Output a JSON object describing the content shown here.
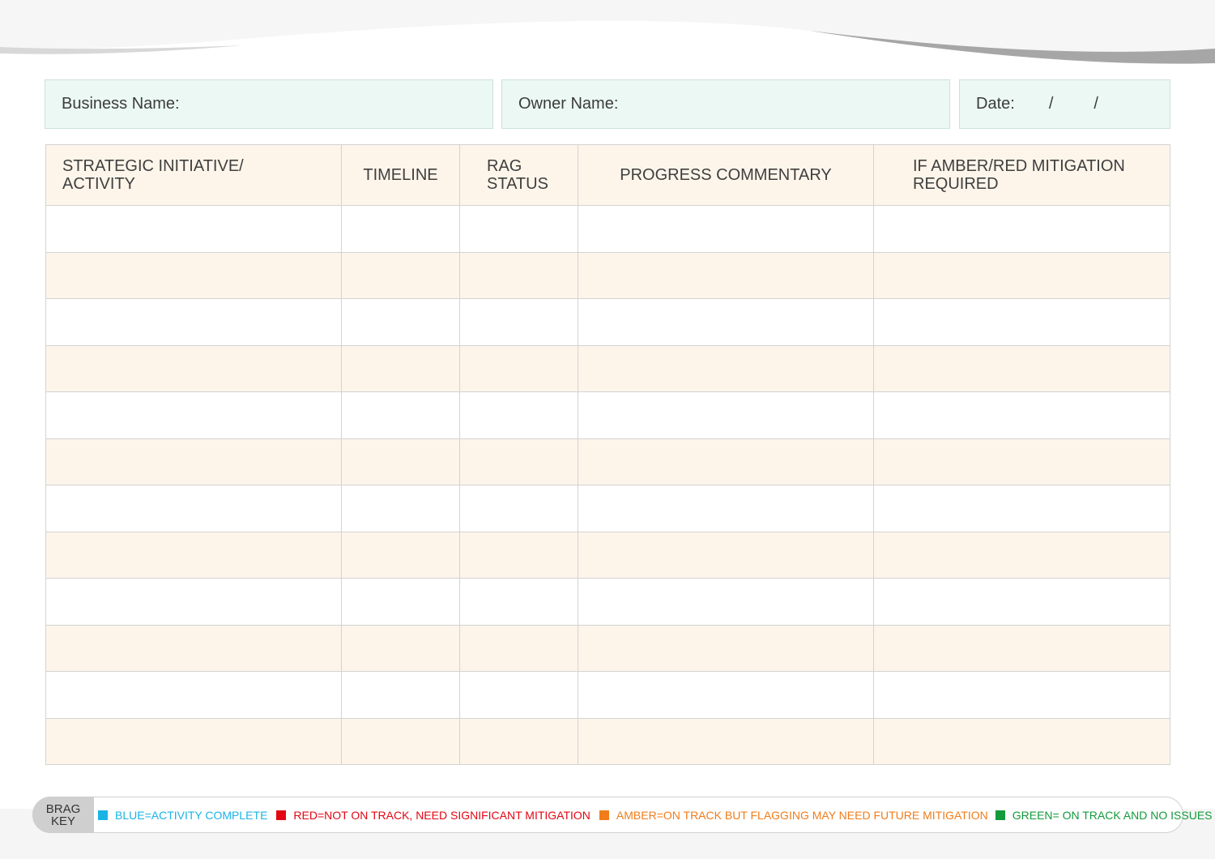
{
  "header_fields": {
    "business_label": "Business Name:",
    "owner_label": "Owner Name:",
    "date_label": "Date:",
    "date_separator": "/"
  },
  "table": {
    "columns": [
      {
        "line1": "STRATEGIC INITIATIVE/",
        "line2": "ACTIVITY"
      },
      {
        "line1": "TIMELINE",
        "line2": ""
      },
      {
        "line1": "RAG",
        "line2": "STATUS"
      },
      {
        "line1": "PROGRESS COMMENTARY",
        "line2": ""
      },
      {
        "line1": "IF AMBER/RED MITIGATION",
        "line2": "REQUIRED"
      }
    ],
    "rows": [
      [
        "",
        "",
        "",
        "",
        ""
      ],
      [
        "",
        "",
        "",
        "",
        ""
      ],
      [
        "",
        "",
        "",
        "",
        ""
      ],
      [
        "",
        "",
        "",
        "",
        ""
      ],
      [
        "",
        "",
        "",
        "",
        ""
      ],
      [
        "",
        "",
        "",
        "",
        ""
      ],
      [
        "",
        "",
        "",
        "",
        ""
      ],
      [
        "",
        "",
        "",
        "",
        ""
      ],
      [
        "",
        "",
        "",
        "",
        ""
      ],
      [
        "",
        "",
        "",
        "",
        ""
      ],
      [
        "",
        "",
        "",
        "",
        ""
      ],
      [
        "",
        "",
        "",
        "",
        ""
      ]
    ],
    "row_colors": {
      "odd": "#ffffff",
      "even": "#fdf5ea"
    }
  },
  "brag_key": {
    "badge_line1": "BRAG",
    "badge_line2": "KEY",
    "items": [
      {
        "label": "BLUE=ACTIVITY COMPLETE",
        "color": "#1ab3e6"
      },
      {
        "label": "RED=NOT ON TRACK, NEED SIGNIFICANT MITIGATION",
        "color": "#e30613"
      },
      {
        "label": "AMBER=ON TRACK BUT FLAGGING MAY NEED FUTURE MITIGATION",
        "color": "#f07d1a"
      },
      {
        "label": "GREEN= ON TRACK AND NO ISSUES",
        "color": "#129a3b"
      }
    ]
  },
  "colors": {
    "field_background": "#ebf8f3",
    "header_background": "#fdf5ea",
    "grid_line": "#d3d3d3"
  }
}
